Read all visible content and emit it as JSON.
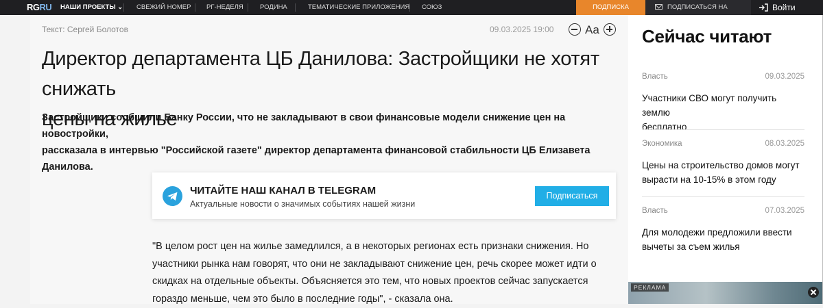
{
  "topbar": {
    "logo_rg": "RG",
    "logo_ru": "RU",
    "nav": [
      {
        "label": "НАШИ ПРОЕКТЫ ⌄"
      },
      {
        "label": "СВЕЖИЙ НОМЕР"
      },
      {
        "label": "РГ-НЕДЕЛЯ"
      },
      {
        "label": "РОДИНА"
      },
      {
        "label": "ТЕМАТИЧЕСКИЕ ПРИЛОЖЕНИЯ"
      },
      {
        "label": "СОЮЗ"
      }
    ],
    "subscribe_label": "ПОДПИСКА",
    "news_subscribe_label": "ПОДПИСАТЬСЯ НА НОВОСТИ",
    "login_label": "Войти",
    "accent_color": "#e8862b"
  },
  "article": {
    "byline": "Текст: Сергей Болотов",
    "date": "09.03.2025 19:00",
    "font_size_label": "Aa",
    "headline_line1": "Директор департамента ЦБ Данилова: Застройщики не хотят снижать",
    "headline_line2": "цены на жилье",
    "lead_line1": "Застройщики сообщили Банку России, что не закладывают в свои финансовые модели снижение цен на новостройки,",
    "lead_line2": "рассказала в интервью \"Российской газете\" директор департамента финансовой стабильности ЦБ Елизавета Данилова.",
    "telegram": {
      "title": "ЧИТАЙТЕ НАШ КАНАЛ В TELEGRAM",
      "subtitle": "Актуальные новости о значимых событиях нашей жизни",
      "button_label": "Подписаться",
      "icon_color": "#2aa2dd"
    },
    "quote_lines": [
      "\"В целом рост цен на жилье замедлился, а в некоторых регионах есть признаки снижения. Но",
      "участники рынка нам говорят, что они не закладывают снижение цен, речь скорее может идти о",
      "скидках на отдельные объекты. Объясняется это тем, что новых проектов сейчас запускается",
      "гораздо меньше, чем это было в последние годы\", - сказала она."
    ]
  },
  "sidebar": {
    "title": "Сейчас читают",
    "items": [
      {
        "category": "Власть",
        "date": "09.03.2025",
        "line1": "Участники СВО могут получить землю",
        "line2": "бесплатно"
      },
      {
        "category": "Экономика",
        "date": "08.03.2025",
        "line1": "Цены на строительство домов могут",
        "line2": "вырасти на 10-15% в этом году"
      },
      {
        "category": "Власть",
        "date": "07.03.2025",
        "line1": "Для молодежи предложили ввести",
        "line2": "вычеты за съем жилья"
      }
    ],
    "ad_label": "РЕКЛАМА"
  }
}
